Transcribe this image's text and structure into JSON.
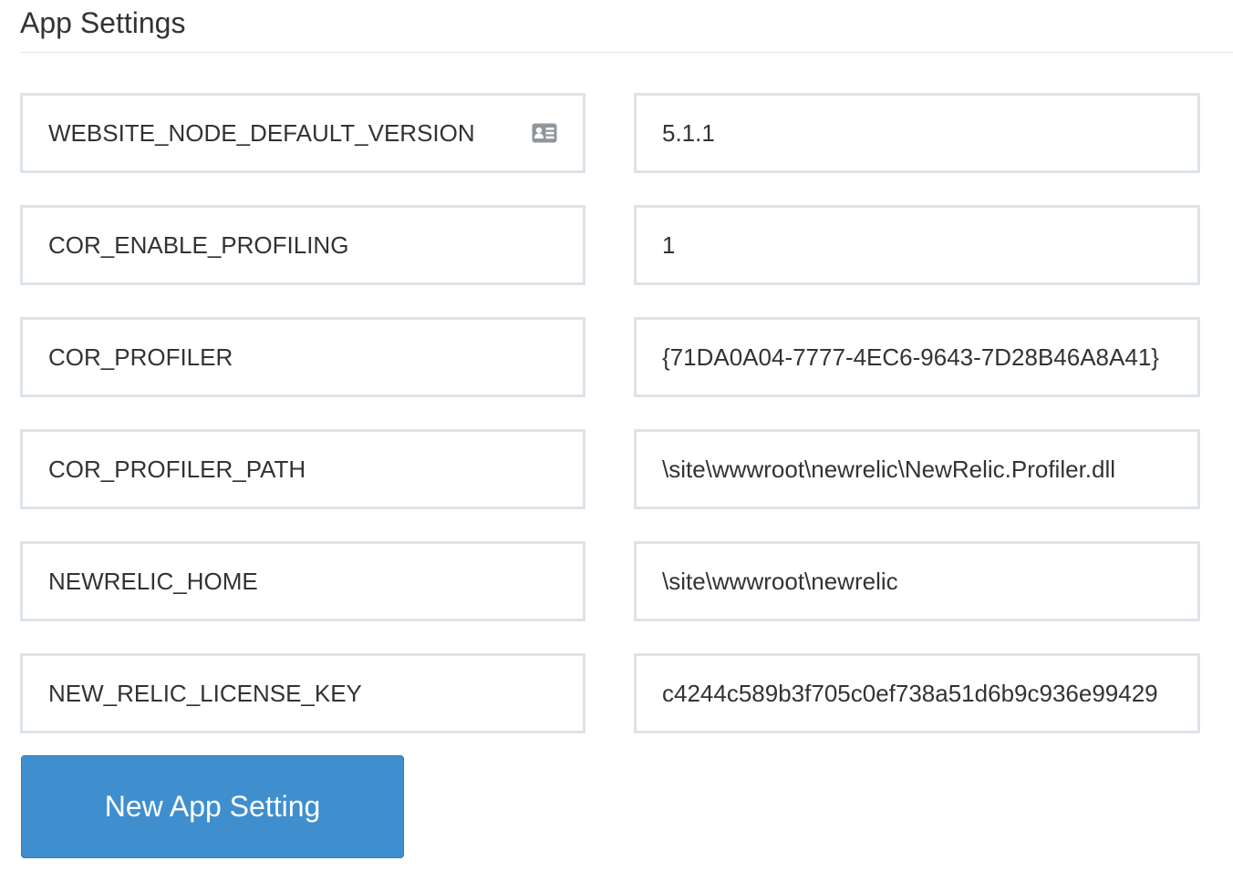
{
  "section": {
    "title": "App Settings"
  },
  "settings": [
    {
      "name": "WEBSITE_NODE_DEFAULT_VERSION",
      "value": "5.1.1",
      "name_icon": "contact-card-icon"
    },
    {
      "name": "COR_ENABLE_PROFILING",
      "value": "1"
    },
    {
      "name": "COR_PROFILER",
      "value": "{71DA0A04-7777-4EC6-9643-7D28B46A8A41}"
    },
    {
      "name": "COR_PROFILER_PATH",
      "value": "\\site\\wwwroot\\newrelic\\NewRelic.Profiler.dll"
    },
    {
      "name": "NEWRELIC_HOME",
      "value": "\\site\\wwwroot\\newrelic"
    },
    {
      "name": "NEW_RELIC_LICENSE_KEY",
      "value": "c4244c589b3f705c0ef738a51d6b9c936e99429"
    }
  ],
  "actions": {
    "new_setting_label": "New App Setting"
  },
  "colors": {
    "button_bg": "#3f8fcf",
    "field_border": "#dde3e8",
    "text": "#333333"
  }
}
